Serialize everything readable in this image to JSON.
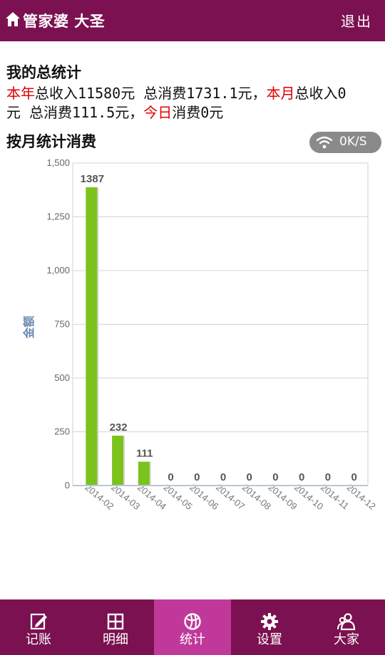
{
  "header": {
    "title": "管家婆 大圣",
    "logout_label": "退出",
    "home_icon": "home-icon"
  },
  "summary": {
    "title": "我的总统计",
    "year_label": "本年",
    "year_text": "总收入11580元 总消费1731.1元，",
    "month_label": "本月",
    "month_text_a": "总收入0",
    "month_text_b": "元 总消费111.5元，",
    "today_label": "今日",
    "today_text": "消费0元"
  },
  "monthly": {
    "title": "按月统计消费",
    "network_speed": "0K/S"
  },
  "chart_data": {
    "type": "bar",
    "ylabel": "金额",
    "ylim": [
      0,
      1500
    ],
    "yticks": [
      0,
      250,
      500,
      750,
      1000,
      1250,
      1500
    ],
    "ytick_labels": [
      "0",
      "250",
      "500",
      "750",
      "1,000",
      "1,250",
      "1,500"
    ],
    "categories": [
      "2014-02",
      "2014-03",
      "2014-04",
      "2014-05",
      "2014-06",
      "2014-07",
      "2014-08",
      "2014-09",
      "2014-10",
      "2014-11",
      "2014-12"
    ],
    "values": [
      1387,
      232,
      111,
      0,
      0,
      0,
      0,
      0,
      0,
      0,
      0
    ],
    "data_labels": [
      "1387",
      "232",
      "111",
      "0",
      "0",
      "0",
      "0",
      "0",
      "0",
      "0",
      "0"
    ],
    "bar_color": "#7cc21c",
    "grid": true
  },
  "tabs": [
    {
      "label": "记账",
      "icon": "edit-icon",
      "active": false
    },
    {
      "label": "明细",
      "icon": "grid-icon",
      "active": false
    },
    {
      "label": "统计",
      "icon": "chart-icon",
      "active": true
    },
    {
      "label": "设置",
      "icon": "gear-icon",
      "active": false
    },
    {
      "label": "大家",
      "icon": "users-icon",
      "active": false
    }
  ],
  "colors": {
    "brand": "#7b1150",
    "active_tab": "#c0399a",
    "highlight": "#e00000"
  }
}
